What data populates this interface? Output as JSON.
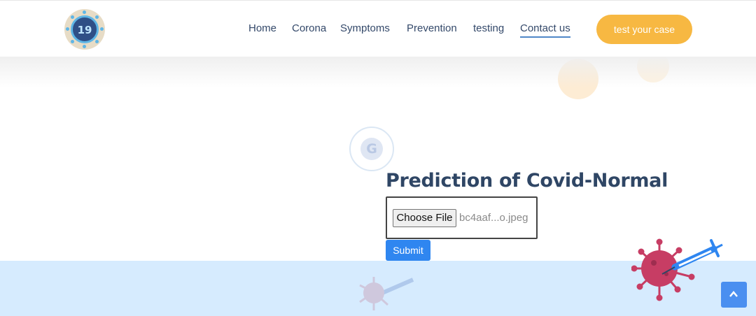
{
  "header": {
    "logo_text": "19",
    "nav": [
      {
        "label": "Home"
      },
      {
        "label": "Corona"
      },
      {
        "label": "Symptoms"
      },
      {
        "label": "Prevention"
      },
      {
        "label": "testing"
      },
      {
        "label": "Contact us",
        "active": true
      }
    ],
    "cta_label": "test your case"
  },
  "main": {
    "badge_letter": "G",
    "title": "Prediction of Covid-Normal",
    "file_input": {
      "button_label": "Choose File",
      "file_name": "bc4aaf...o.jpeg"
    },
    "submit_label": "Submit"
  },
  "icons": {
    "logo": "covid-19-logo",
    "badge": "g-badge-icon",
    "virus_syringe": "virus-syringe-illustration",
    "scroll_top": "chevron-up-icon"
  },
  "colors": {
    "nav_text": "#34496a",
    "cta_bg": "#f7b842",
    "title": "#2f4665",
    "submit_bg": "#2f86f0",
    "bottom_band": "#d6ebfe",
    "scroll_top_bg": "#4a8ff0"
  }
}
